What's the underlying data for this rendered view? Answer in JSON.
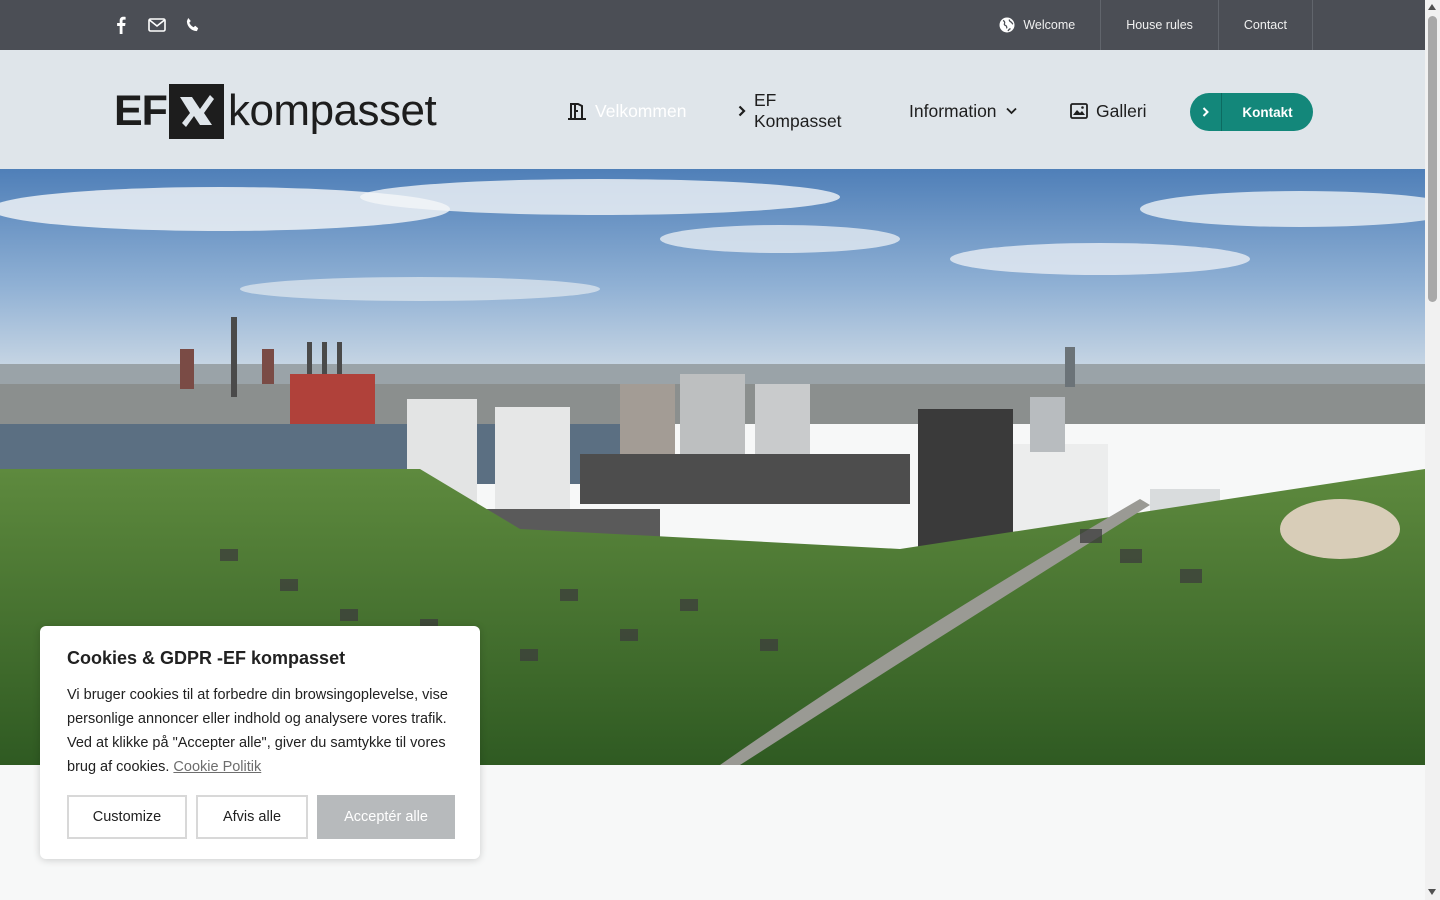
{
  "topbar": {
    "social": [
      {
        "icon": "facebook-icon"
      },
      {
        "icon": "mail-icon"
      },
      {
        "icon": "phone-icon"
      }
    ],
    "links": [
      {
        "label": "Welcome",
        "icon": "globe-icon"
      },
      {
        "label": "House rules"
      },
      {
        "label": "Contact"
      }
    ]
  },
  "logo": {
    "prefix": "EF",
    "suffix": "kompasset"
  },
  "nav": {
    "items": [
      {
        "label": "Velkommen",
        "icon": "door-icon",
        "active": true
      },
      {
        "label": "EF Kompasset",
        "icon": "chevron-right-icon"
      },
      {
        "label": "Information",
        "icon": "chevron-down-icon"
      },
      {
        "label": "Galleri",
        "icon": "gallery-icon"
      }
    ],
    "cta": "Kontakt"
  },
  "cookie": {
    "title": "Cookies & GDPR -EF kompasset",
    "body": "Vi bruger cookies til at forbedre din browsingoplevelse, vise personlige annoncer eller indhold og analysere vores trafik. Ved at klikke på \"Accepter alle\", giver du samtykke til vores brug af cookies.",
    "link": "Cookie Politik",
    "buttons": {
      "customize": "Customize",
      "reject": "Afvis alle",
      "accept": "Acceptér alle"
    }
  },
  "colors": {
    "topbar": "#4b4e55",
    "header": "#dfe5ea",
    "accent": "#13877a",
    "accept_button": "#b7babc"
  }
}
